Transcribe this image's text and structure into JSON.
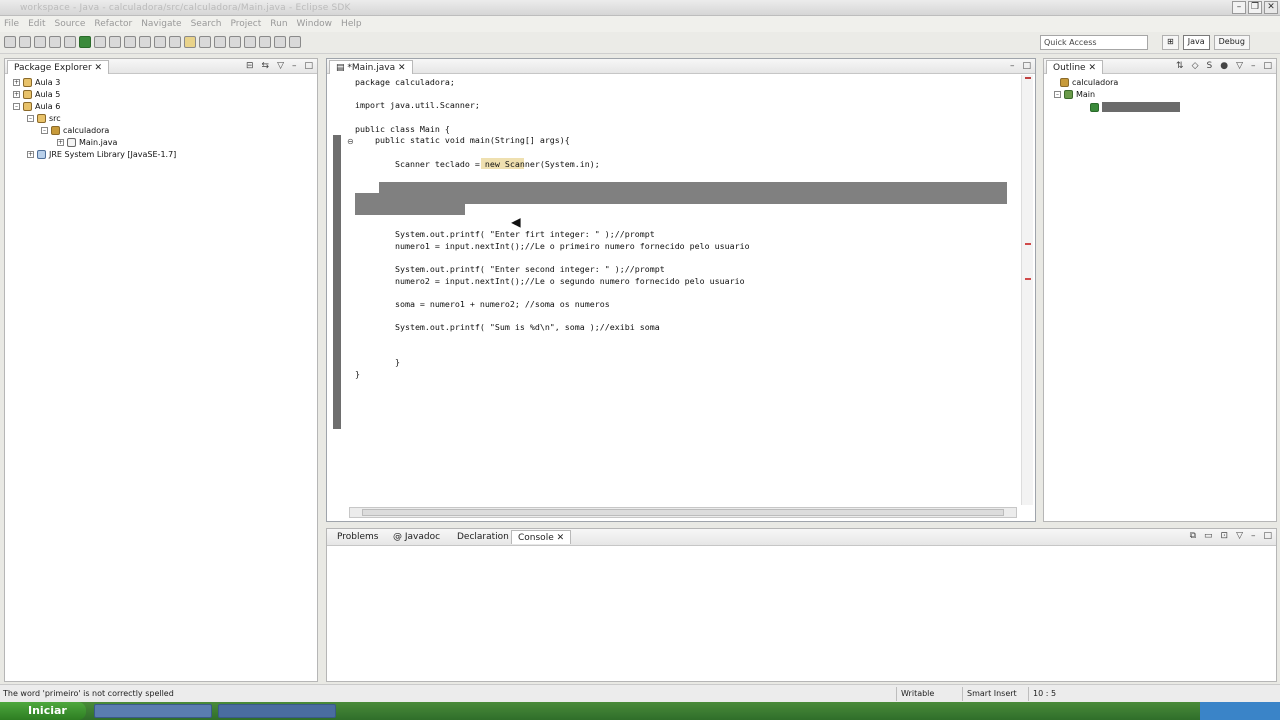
{
  "window": {
    "title": "workspace - Java - calculadora/src/calculadora/Main.java - Eclipse SDK"
  },
  "menu": [
    "File",
    "Edit",
    "Source",
    "Refactor",
    "Navigate",
    "Search",
    "Project",
    "Run",
    "Window",
    "Help"
  ],
  "toolbar": {
    "quick_access_placeholder": "Quick Access",
    "perspectives": [
      "Java",
      "Debug"
    ]
  },
  "package_explorer": {
    "title": "Package Explorer",
    "items": [
      {
        "label": "Aula 3"
      },
      {
        "label": "Aula 5"
      },
      {
        "label": "Aula 6"
      },
      {
        "label": "src"
      },
      {
        "label": "calculadora"
      },
      {
        "label": "Main.java"
      },
      {
        "label": "JRE System Library [JavaSE-1.7]"
      }
    ]
  },
  "editor": {
    "tab_label": "*Main.java",
    "lines": [
      {
        "text": "package calculadora;"
      },
      {
        "text": "import java.util.Scanner;"
      },
      {
        "text": "public class Main {"
      },
      {
        "text": "    public static void main(String[] args){"
      },
      {
        "text": "        Scanner teclado = new Scanner(System.in);"
      },
      {
        "text": "        System.out.printf( \"Enter firt integer: \" );//prompt"
      },
      {
        "text": "        numero1 = input.nextInt();//Le o primeiro numero fornecido pelo usuario"
      },
      {
        "text": "        System.out.printf( \"Enter second integer: \" );//prompt"
      },
      {
        "text": "        numero2 = input.nextInt();//Le o segundo numero fornecido pelo usuario"
      },
      {
        "text": "        soma = numero1 + numero2; //soma os numeros"
      },
      {
        "text": "        System.out.printf( \"Sum is %d\\n\", soma );//exibi soma"
      },
      {
        "text": "        }"
      },
      {
        "text": "}"
      }
    ]
  },
  "outline": {
    "title": "Outline",
    "items": [
      {
        "label": "calculadora"
      },
      {
        "label": "Main"
      }
    ]
  },
  "console_tabs": [
    {
      "label": "Problems"
    },
    {
      "label": "@ Javadoc"
    },
    {
      "label": "Declaration"
    },
    {
      "label": "Console"
    }
  ],
  "status": {
    "message": "The word 'primeiro' is not correctly spelled",
    "writable": "Writable",
    "insert_mode": "Smart Insert",
    "position": "10 : 5"
  },
  "taskbar": {
    "start_label": "Iniciar"
  }
}
